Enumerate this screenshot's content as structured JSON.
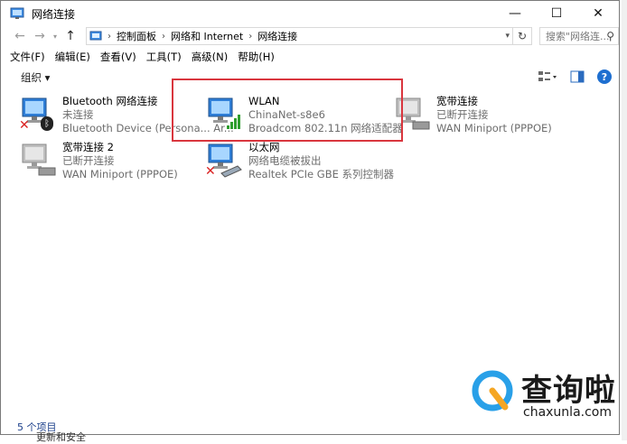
{
  "window": {
    "title": "网络连接"
  },
  "address": {
    "crumbs": [
      "控制面板",
      "网络和 Internet",
      "网络连接"
    ],
    "search_placeholder": "搜索\"网络连..."
  },
  "menu": [
    "文件(F)",
    "编辑(E)",
    "查看(V)",
    "工具(T)",
    "高级(N)",
    "帮助(H)"
  ],
  "toolbar": {
    "organize": "组织 ▾"
  },
  "connections": [
    {
      "name": "Bluetooth 网络连接",
      "status": "未连接",
      "device": "Bluetooth Device (Persona... Ar..."
    },
    {
      "name": "WLAN",
      "status": "ChinaNet-s8e6",
      "device": "Broadcom 802.11n 网络适配器"
    },
    {
      "name": "宽带连接",
      "status": "已断开连接",
      "device": "WAN Miniport (PPPOE)"
    },
    {
      "name": "宽带连接 2",
      "status": "已断开连接",
      "device": "WAN Miniport (PPPOE)"
    },
    {
      "name": "以太网",
      "status": "网络电缆被拔出",
      "device": "Realtek PCIe GBE 系列控制器"
    }
  ],
  "statusbar": {
    "count": "5 个项目"
  },
  "watermark": {
    "brand": "查询啦",
    "url": "chaxunla.com"
  },
  "bg_text": "更新和安全",
  "colors": {
    "highlight": "#d9363e",
    "accent": "#1e6fd0"
  }
}
